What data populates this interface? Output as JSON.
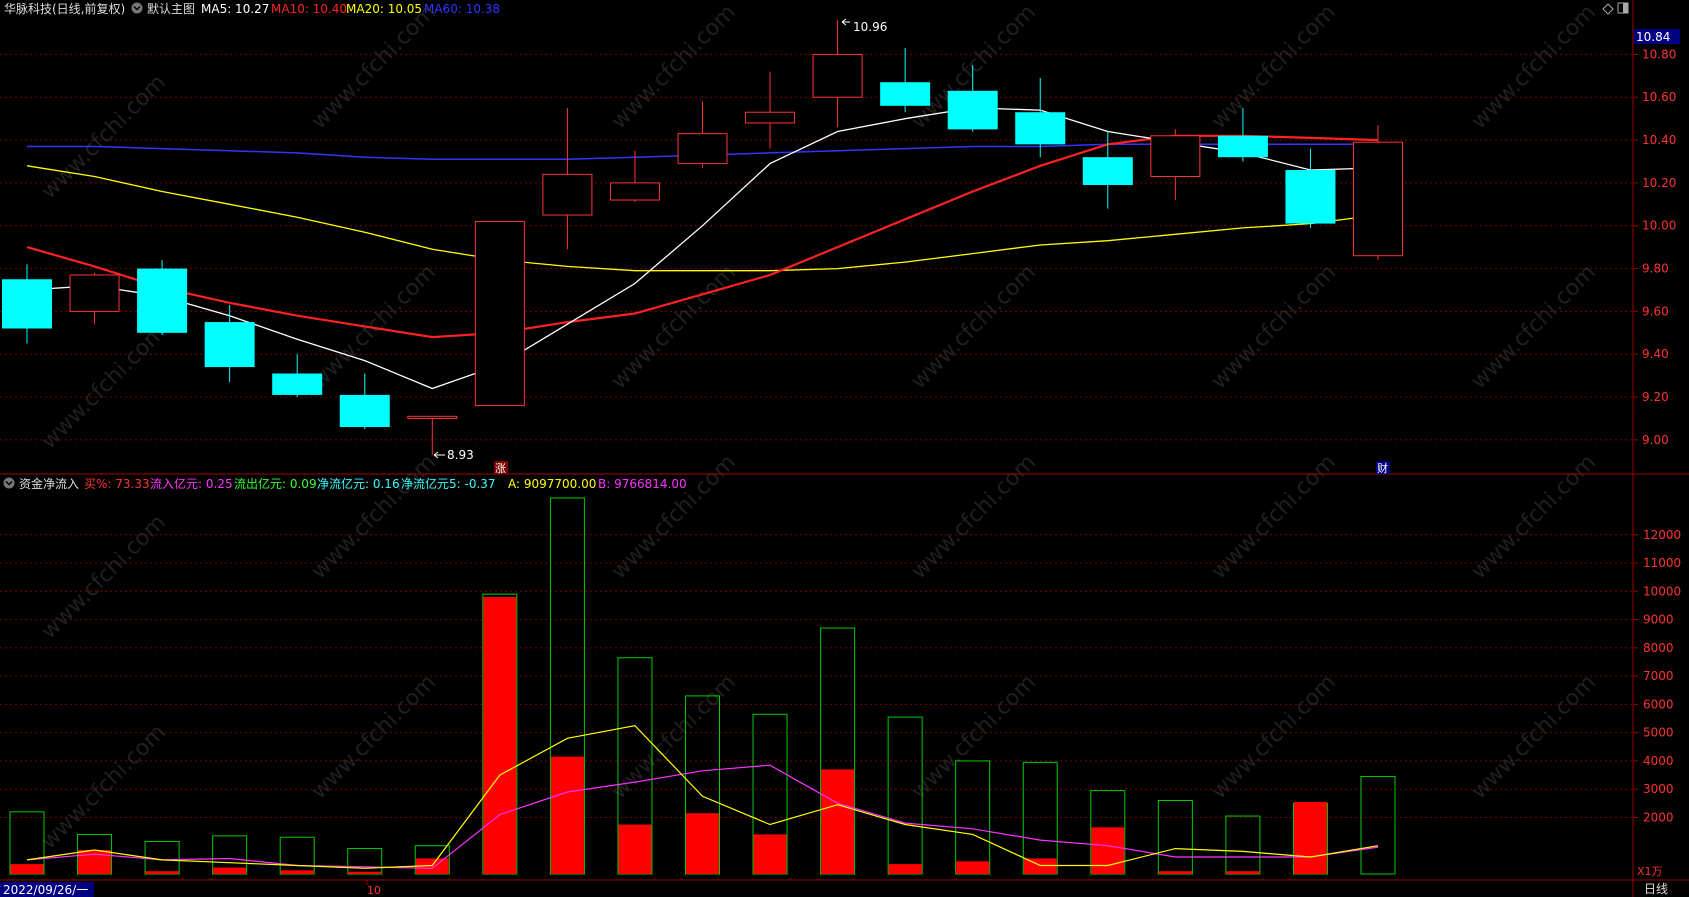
{
  "header": {
    "stock_title": "华脉科技(日线,前复权)",
    "main_chart_label": "默认主图",
    "ma": [
      {
        "label": "MA5: 10.27",
        "color": "#ffffff"
      },
      {
        "label": "MA10: 10.40",
        "color": "#ff2222"
      },
      {
        "label": "MA20: 10.05",
        "color": "#ffff00"
      },
      {
        "label": "MA60: 10.38",
        "color": "#3333ff"
      }
    ]
  },
  "sub_header": {
    "indicator_label": "资金净流入",
    "items": [
      {
        "label": "买%: 73.33",
        "color": "#ff3333"
      },
      {
        "label": "流入亿元: 0.25",
        "color": "#ff33ff"
      },
      {
        "label": "流出亿元: 0.09",
        "color": "#33ff33"
      },
      {
        "label": "净流亿元: 0.16",
        "color": "#33ffff"
      },
      {
        "label": "净流亿元5: -0.37",
        "color": "#33ffff"
      },
      {
        "label": "A: 9097700.00",
        "color": "#ffff00"
      },
      {
        "label": "B: 9766814.00",
        "color": "#ff33ff"
      }
    ]
  },
  "annotations": {
    "high_label": "10.96",
    "low_label": "8.93",
    "current_price": "10.84",
    "zhang_marker": "涨",
    "cai_marker": "财"
  },
  "footer": {
    "date_label": "2022/09/26/一",
    "month_tick": "10",
    "unit_label": "X1万",
    "period_label": "日线"
  },
  "watermark": "www.cfchi.com",
  "colors": {
    "up": "#ff3333",
    "down": "#00ffff",
    "grid": "#7a0000",
    "axis_text": "#ff3333",
    "ma5": "#ffffff",
    "ma10": "#ff2222",
    "ma20": "#ffff00",
    "ma60": "#3333ff",
    "flow_in": "#ff0000",
    "flow_out": "#00cc00",
    "line_a": "#ffff00",
    "line_b": "#ff33ff"
  },
  "chart_data": [
    {
      "type": "candlestick",
      "ylim": [
        8.85,
        10.97
      ],
      "y_ticks": [
        9.0,
        9.2,
        9.4,
        9.6,
        9.8,
        10.0,
        10.2,
        10.4,
        10.6,
        10.8
      ],
      "candles": [
        {
          "o": 9.75,
          "h": 9.82,
          "l": 9.45,
          "c": 9.52
        },
        {
          "o": 9.6,
          "h": 9.78,
          "l": 9.54,
          "c": 9.77
        },
        {
          "o": 9.8,
          "h": 9.84,
          "l": 9.49,
          "c": 9.5
        },
        {
          "o": 9.55,
          "h": 9.63,
          "l": 9.27,
          "c": 9.34
        },
        {
          "o": 9.31,
          "h": 9.4,
          "l": 9.2,
          "c": 9.21
        },
        {
          "o": 9.21,
          "h": 9.31,
          "l": 9.05,
          "c": 9.06
        },
        {
          "o": 9.1,
          "h": 9.11,
          "l": 8.93,
          "c": 9.11
        },
        {
          "o": 9.16,
          "h": 10.02,
          "l": 9.16,
          "c": 10.02
        },
        {
          "o": 10.05,
          "h": 10.55,
          "l": 9.89,
          "c": 10.24
        },
        {
          "o": 10.12,
          "h": 10.35,
          "l": 10.11,
          "c": 10.2
        },
        {
          "o": 10.29,
          "h": 10.58,
          "l": 10.27,
          "c": 10.43
        },
        {
          "o": 10.48,
          "h": 10.72,
          "l": 10.36,
          "c": 10.53
        },
        {
          "o": 10.6,
          "h": 10.96,
          "l": 10.46,
          "c": 10.8
        },
        {
          "o": 10.67,
          "h": 10.83,
          "l": 10.53,
          "c": 10.56
        },
        {
          "o": 10.63,
          "h": 10.75,
          "l": 10.44,
          "c": 10.45
        },
        {
          "o": 10.53,
          "h": 10.69,
          "l": 10.32,
          "c": 10.38
        },
        {
          "o": 10.32,
          "h": 10.44,
          "l": 10.08,
          "c": 10.19
        },
        {
          "o": 10.23,
          "h": 10.45,
          "l": 10.12,
          "c": 10.42
        },
        {
          "o": 10.42,
          "h": 10.55,
          "l": 10.3,
          "c": 10.32
        },
        {
          "o": 10.26,
          "h": 10.36,
          "l": 9.99,
          "c": 10.01
        },
        {
          "o": 9.86,
          "h": 10.47,
          "l": 9.84,
          "c": 10.39
        }
      ],
      "ma5": [
        9.7,
        9.72,
        9.67,
        9.58,
        9.47,
        9.37,
        9.24,
        9.35,
        9.54,
        9.73,
        10.0,
        10.29,
        10.44,
        10.5,
        10.55,
        10.54,
        10.44,
        10.39,
        10.34,
        10.26,
        10.27
      ],
      "ma10": [
        9.9,
        9.81,
        9.71,
        9.64,
        9.58,
        9.53,
        9.48,
        9.5,
        9.55,
        9.59,
        9.68,
        9.77,
        9.9,
        10.03,
        10.16,
        10.28,
        10.38,
        10.42,
        10.42,
        10.41,
        10.4
      ],
      "ma20": [
        10.28,
        10.23,
        10.16,
        10.1,
        10.04,
        9.97,
        9.89,
        9.84,
        9.81,
        9.79,
        9.79,
        9.79,
        9.8,
        9.83,
        9.87,
        9.91,
        9.93,
        9.96,
        9.99,
        10.01,
        10.05
      ],
      "ma60": [
        10.37,
        10.37,
        10.36,
        10.35,
        10.34,
        10.32,
        10.31,
        10.31,
        10.31,
        10.32,
        10.33,
        10.34,
        10.35,
        10.36,
        10.37,
        10.37,
        10.38,
        10.38,
        10.38,
        10.38,
        10.38
      ]
    },
    {
      "type": "bar",
      "unit": "万",
      "ylim": [
        0,
        13300
      ],
      "y_ticks": [
        2000,
        3000,
        4000,
        5000,
        6000,
        7000,
        8000,
        9000,
        10000,
        11000,
        12000
      ],
      "inflow": [
        350,
        850,
        100,
        230,
        130,
        80,
        550,
        9800,
        4150,
        1750,
        2150,
        1400,
        3700,
        350,
        450,
        550,
        1650,
        100,
        100,
        2550
      ],
      "outflow": [
        2200,
        1400,
        1150,
        1350,
        1300,
        900,
        1000,
        9900,
        13300,
        7650,
        6300,
        5650,
        8700,
        5550,
        4000,
        3950,
        2950,
        2600,
        2050,
        2500,
        3450
      ],
      "line_a": [
        500,
        850,
        500,
        400,
        300,
        200,
        300,
        3500,
        4800,
        5250,
        2750,
        1750,
        2450,
        1750,
        1400,
        300,
        300,
        900,
        800,
        600,
        1000
      ],
      "line_b": [
        500,
        700,
        500,
        550,
        300,
        250,
        200,
        2100,
        2900,
        3250,
        3650,
        3850,
        2500,
        1800,
        1600,
        1200,
        1000,
        600,
        600,
        600,
        950
      ]
    }
  ]
}
